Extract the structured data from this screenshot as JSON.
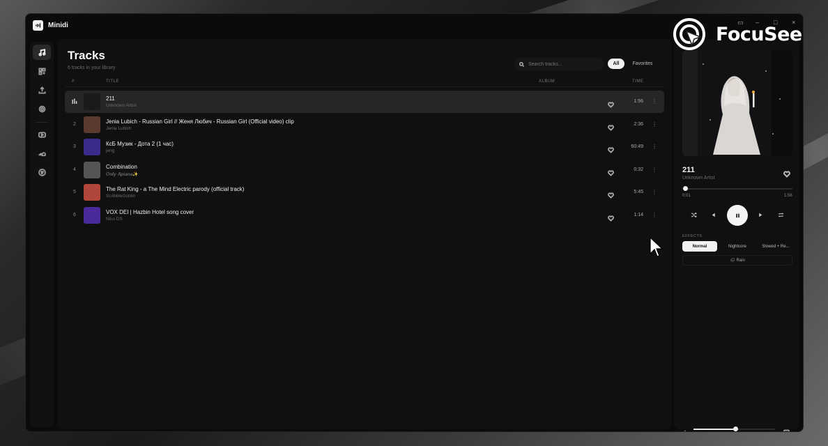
{
  "app": {
    "name": "Minidi"
  },
  "tracks_view": {
    "title": "Tracks",
    "subtitle": "6 tracks in your library",
    "search_placeholder": "Search tracks...",
    "filters": {
      "all": "All",
      "favorites": "Favorites"
    },
    "columns": {
      "num": "#",
      "title": "TITLE",
      "album": "ALBUM",
      "time": "TIME"
    },
    "tracks": [
      {
        "num": "1",
        "title": "211",
        "artist": "Unknown Artist",
        "time": "1:56",
        "playing": true,
        "art_color": "#1a1a1a"
      },
      {
        "num": "2",
        "title": "Jenia Lubich - Russian Girl // Женя Любич - Russian Girl (Official video) clip",
        "artist": "Jenia Lubich",
        "time": "2:36",
        "playing": false,
        "art_color": "#5a3a2e"
      },
      {
        "num": "3",
        "title": "КсБ Музик - Дота 2 (1 час)",
        "artist": "jeng",
        "time": "60:49",
        "playing": false,
        "art_color": "#3a2a8a"
      },
      {
        "num": "4",
        "title": "Combination",
        "artist": "𝑶𝒏𝒍𝒚 𝑨𝒑𝒊𝒂𝒏𝒂✨",
        "time": "0:32",
        "playing": false,
        "art_color": "#555555"
      },
      {
        "num": "5",
        "title": "The Rat King - a The Mind Electric parody (official track)",
        "artist": "ScribbleGoblin",
        "time": "5:45",
        "playing": false,
        "art_color": "#b0453a"
      },
      {
        "num": "6",
        "title": "VOX DEI | Hazbin Hotel song cover",
        "artist": "Nico DS",
        "time": "1:14",
        "playing": false,
        "art_color": "#4a2a9a"
      }
    ]
  },
  "now_playing": {
    "title": "211",
    "artist": "Unknown Artist",
    "elapsed": "0:01",
    "duration": "1:56",
    "progress_fraction": 0.01,
    "volume_fraction": 0.51,
    "effects_label": "EFFECTS",
    "effects": [
      "Normal",
      "Nightcore",
      "Slowed + Re..."
    ],
    "active_effect": "Normal",
    "rain_label": "🌧 Rain"
  },
  "watermark": {
    "text": "FocuSee"
  }
}
